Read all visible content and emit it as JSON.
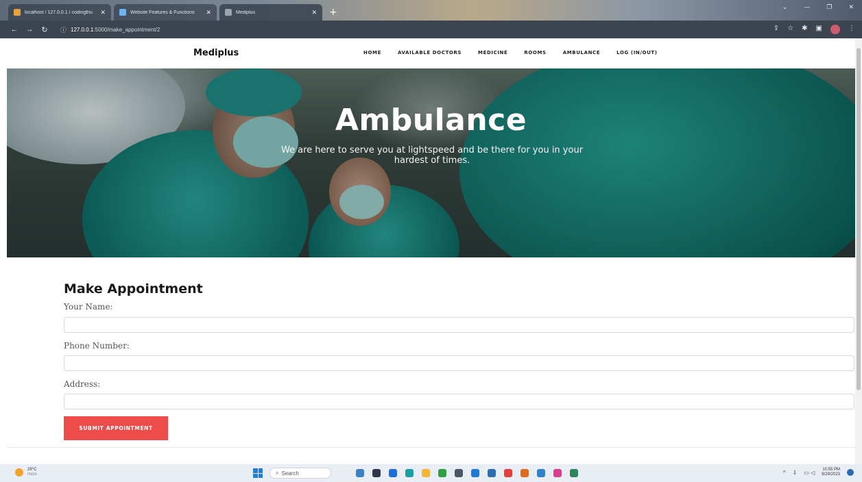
{
  "browser": {
    "tabs": [
      {
        "label": "localhost / 127.0.0.1 / codingthu",
        "fav_color": "#e8a33a"
      },
      {
        "label": "Website Features & Functions",
        "fav_color": "#6cb3f2"
      },
      {
        "label": "Mediplus",
        "fav_color": "#9aa5b1"
      }
    ],
    "new_tab": "+",
    "url_host": "127.0.0.1",
    "url_path": ":5000/make_appointment/2"
  },
  "site": {
    "brand": "Mediplus",
    "nav": [
      "HOME",
      "AVAILABLE DOCTORS",
      "MEDICINE",
      "ROOMS",
      "AMBULANCE",
      "LOG (IN/OUT)"
    ]
  },
  "hero": {
    "title": "Ambulance",
    "subtitle": "We are here to serve you at lightspeed and be there for you in your hardest of times."
  },
  "form": {
    "title": "Make Appointment",
    "name_label": "Your Name:",
    "phone_label": "Phone Number:",
    "address_label": "Address:",
    "submit_label": "SUBMIT APPOINTMENT"
  },
  "taskbar": {
    "temperature": "29°C",
    "condition": "Haze",
    "search_placeholder": "Search",
    "time": "10:55 PM",
    "date": "8/29/2023"
  },
  "colors": {
    "accent": "#ec4d4b",
    "scrub": "#1f8c86"
  }
}
